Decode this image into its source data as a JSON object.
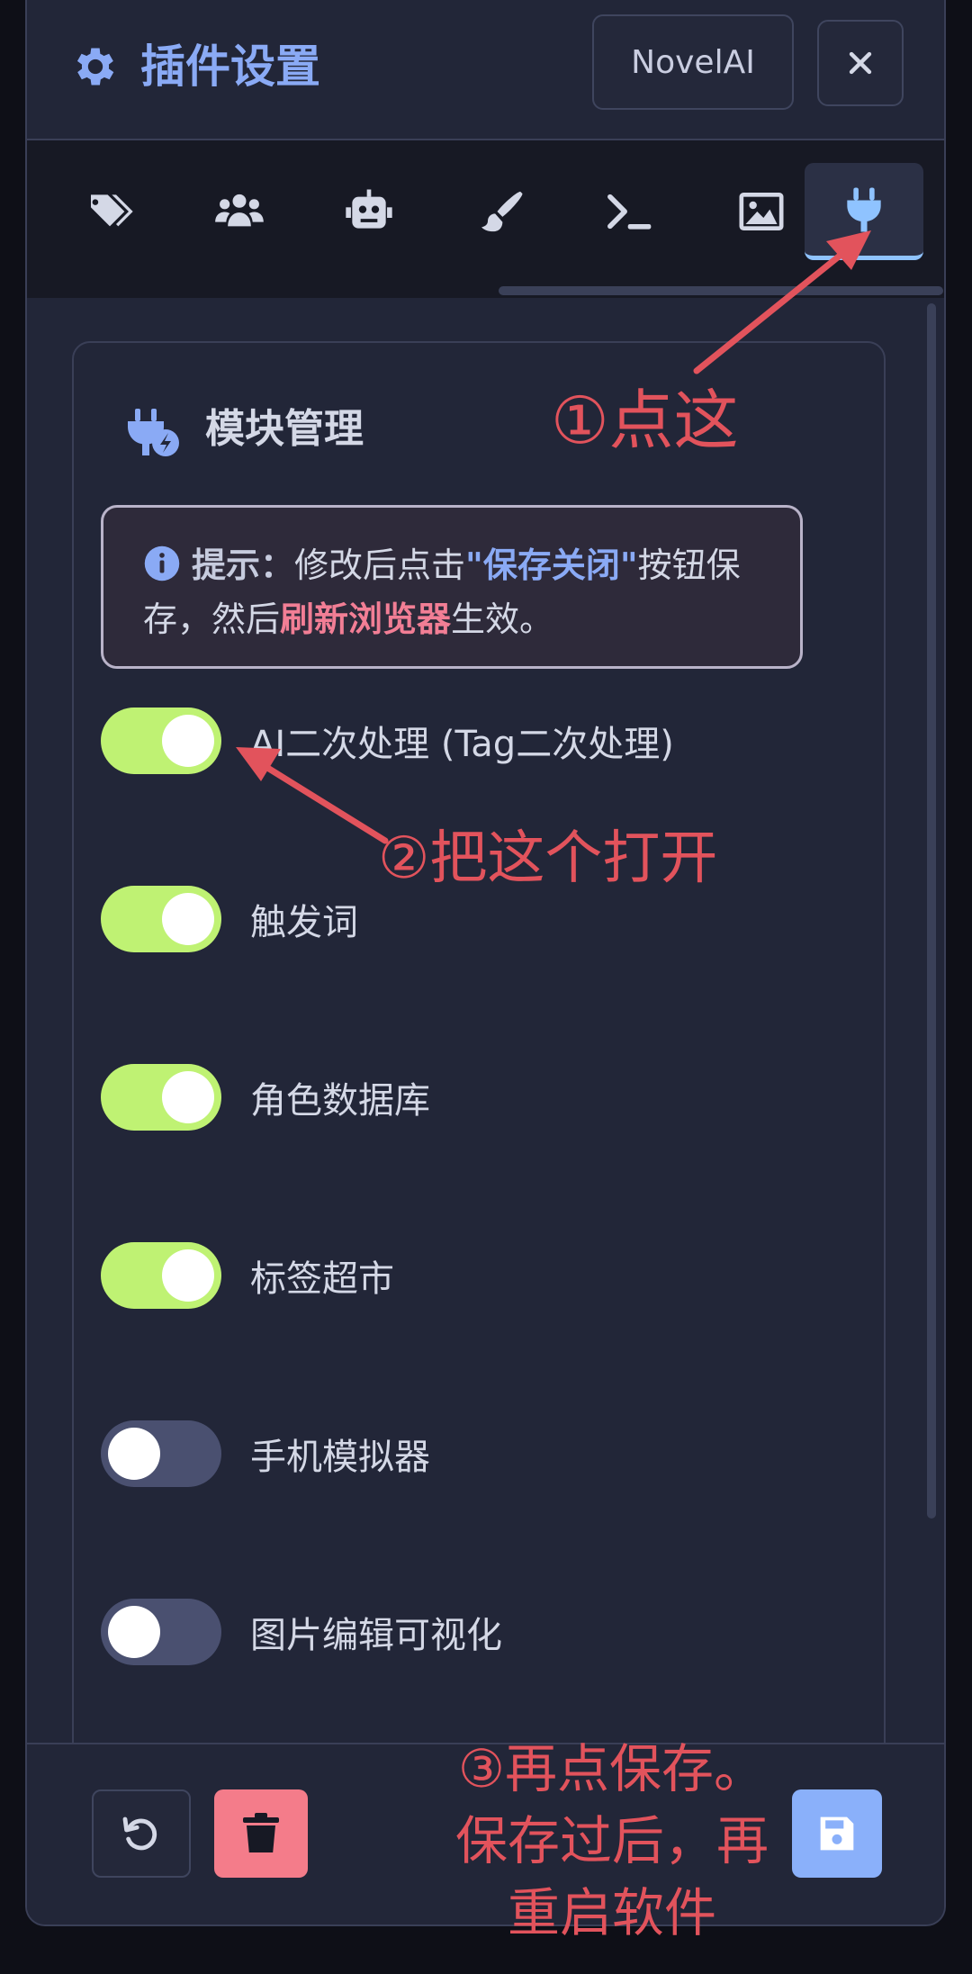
{
  "header": {
    "title": "插件设置",
    "novel_button": "NovelAI",
    "icon": "gear-icon"
  },
  "tabs": [
    {
      "icon": "tags-icon",
      "active": false
    },
    {
      "icon": "users-icon",
      "active": false
    },
    {
      "icon": "robot-icon",
      "active": false
    },
    {
      "icon": "paintbrush-icon",
      "active": false
    },
    {
      "icon": "terminal-icon",
      "active": false
    },
    {
      "icon": "image-icon",
      "active": false
    },
    {
      "icon": "plug-icon",
      "active": true
    }
  ],
  "module_card": {
    "title": "模块管理",
    "hint": {
      "label": "提示：",
      "text1": "修改后点击",
      "highlight1": "\"保存关闭\"",
      "text2": "按钮保存，然后",
      "highlight2": "刷新浏览器",
      "text3": "生效。"
    },
    "toggles": [
      {
        "label": "AI二次处理 (Tag二次处理)",
        "on": true
      },
      {
        "label": "触发词",
        "on": true
      },
      {
        "label": "角色数据库",
        "on": true
      },
      {
        "label": "标签超市",
        "on": true
      },
      {
        "label": "手机模拟器",
        "on": false
      },
      {
        "label": "图片编辑可视化",
        "on": false
      }
    ]
  },
  "footer": {
    "buttons": [
      "reset-icon",
      "trash-icon",
      "save-icon"
    ]
  },
  "annotations": {
    "step1": "①点这",
    "step2": "②把这个打开",
    "step3_line1": "③再点保存。",
    "step3_line2": "保存过后，再",
    "step3_line3": "重启软件"
  },
  "colors": {
    "accent": "#8aaaf5",
    "toggle_on": "#bff273",
    "toggle_off": "#4a5070",
    "danger": "#f47c8a",
    "annotation": "#e2535c"
  }
}
